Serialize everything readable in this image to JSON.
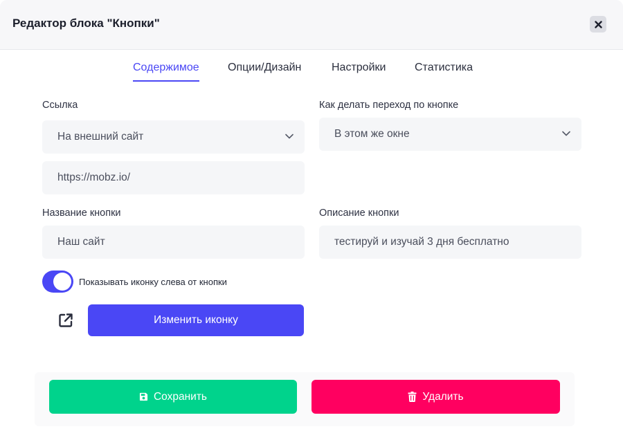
{
  "modal": {
    "title": "Редактор блока \"Кнопки\"",
    "close_icon": "close-icon"
  },
  "tabs": [
    {
      "label": "Содержимое",
      "active": true
    },
    {
      "label": "Опции/Дизайн",
      "active": false
    },
    {
      "label": "Настройки",
      "active": false
    },
    {
      "label": "Статистика",
      "active": false
    }
  ],
  "form": {
    "link": {
      "label": "Ссылка",
      "type_value": "На внешний сайт",
      "url_value": "https://mobz.io/"
    },
    "transition": {
      "label": "Как делать переход по кнопке",
      "value": "В этом же окне"
    },
    "button_name": {
      "label": "Название кнопки",
      "value": "Наш сайт"
    },
    "button_description": {
      "label": "Описание кнопки",
      "value": "тестируй и изучай 3 дня бесплатно"
    },
    "show_icon": {
      "label": "Показывать иконку слева от кнопки",
      "enabled": true
    },
    "icon": {
      "name": "external-link-icon",
      "change_label": "Изменить иконку"
    }
  },
  "actions": {
    "save_label": "Сохранить",
    "save_icon": "save-icon",
    "delete_label": "Удалить",
    "delete_icon": "trash-icon"
  },
  "colors": {
    "accent": "#4a47f5",
    "save": "#00d38c",
    "delete": "#ff0060"
  }
}
